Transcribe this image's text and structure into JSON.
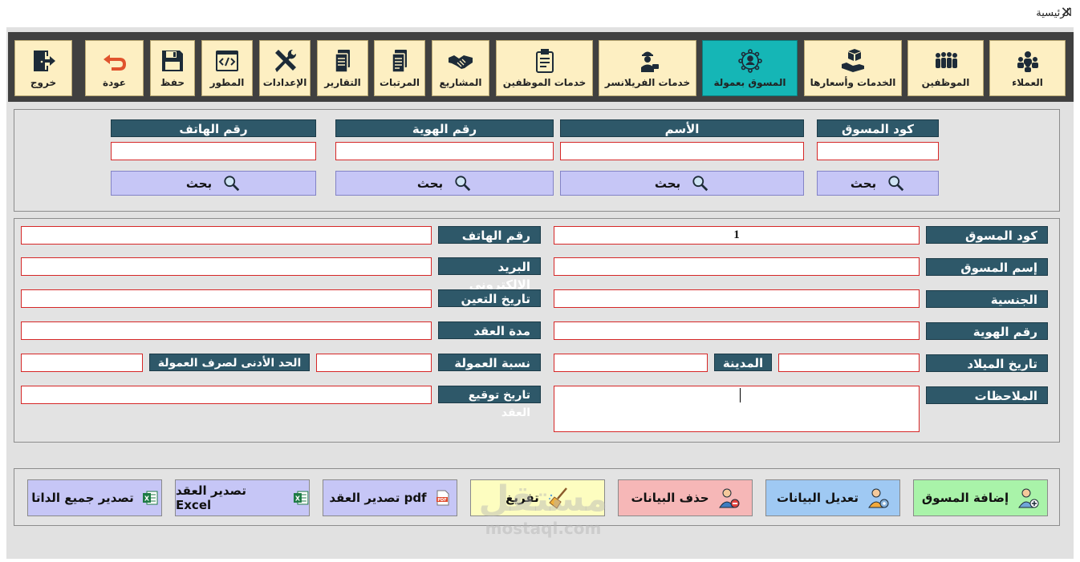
{
  "window": {
    "title": "الرئيسية",
    "close": "✕"
  },
  "toolbar": {
    "items": [
      {
        "id": "clients",
        "label": "العملاء",
        "icon": "group-icon"
      },
      {
        "id": "employees",
        "label": "الموظفين",
        "icon": "crowd-icon"
      },
      {
        "id": "services",
        "label": "الخدمات وأسعارها",
        "icon": "service-box-icon"
      },
      {
        "id": "commission-marketer",
        "label": "المسوق بعمولة",
        "icon": "network-person-icon",
        "active": true
      },
      {
        "id": "freelancer",
        "label": "خدمات الفريلانسر",
        "icon": "worker-icon"
      },
      {
        "id": "employee-services",
        "label": "خدمات الموظفين",
        "icon": "clipboard-icon"
      },
      {
        "id": "projects",
        "label": "المشاريع",
        "icon": "handshake-icon"
      },
      {
        "id": "salaries",
        "label": "المرتبات",
        "icon": "documents-icon"
      },
      {
        "id": "reports",
        "label": "التقارير",
        "icon": "report-icon"
      },
      {
        "id": "settings",
        "label": "الإعدادات",
        "icon": "tools-icon"
      },
      {
        "id": "developer",
        "label": "المطور",
        "icon": "code-icon"
      },
      {
        "id": "save",
        "label": "حفظ",
        "icon": "floppy-icon"
      },
      {
        "id": "back",
        "label": "عودة",
        "icon": "undo-arrow-icon"
      },
      {
        "id": "exit",
        "label": "خروج",
        "icon": "exit-door-icon"
      }
    ]
  },
  "search": {
    "columns": [
      {
        "id": "code",
        "header": "كود المسوق",
        "value": "",
        "button": "بحث"
      },
      {
        "id": "name",
        "header": "الأسم",
        "value": "",
        "button": "بحث"
      },
      {
        "id": "id-number",
        "header": "رقم الهوية",
        "value": "",
        "button": "بحث"
      },
      {
        "id": "phone",
        "header": "رقم الهاتف",
        "value": "",
        "button": "بحث"
      }
    ]
  },
  "details": {
    "right": {
      "code": {
        "label": "كود المسوق",
        "value": "1"
      },
      "name": {
        "label": "إسم المسوق",
        "value": ""
      },
      "nationality": {
        "label": "الجنسية",
        "value": ""
      },
      "id_number": {
        "label": "رقم الهوية",
        "value": ""
      },
      "birth_date": {
        "label": "تاريخ الميلاد",
        "value": ""
      },
      "city": {
        "label": "المدينة",
        "value": ""
      },
      "notes": {
        "label": "الملاحظات",
        "value": ""
      }
    },
    "left": {
      "phone": {
        "label": "رقم الهاتف",
        "value": ""
      },
      "email": {
        "label": "البريد الإلكتروني",
        "value": ""
      },
      "hire_date": {
        "label": "تاريخ التعين",
        "value": ""
      },
      "contract_duration": {
        "label": "مدة العقد",
        "value": ""
      },
      "commission_rate": {
        "label": "نسبة العمولة",
        "value": ""
      },
      "min_commission": {
        "label": "الحد الأدنى لصرف العمولة",
        "value": ""
      },
      "contract_sign_date": {
        "label": "تاريخ توقيع العقد",
        "value": ""
      }
    }
  },
  "actions": {
    "add": {
      "label": "إضافة المسوق",
      "color": "#a9f3a9",
      "icon": "add-user-icon"
    },
    "edit": {
      "label": "تعديل البيانات",
      "color": "#9fc9f3",
      "icon": "user-settings-icon"
    },
    "delete": {
      "label": "حذف البيانات",
      "color": "#f6b7b7",
      "icon": "remove-user-icon"
    },
    "clear": {
      "label": "تفريغ",
      "color": "#fdfdc0",
      "icon": "broom-icon"
    },
    "export_pdf": {
      "label": "تصدير العقد pdf",
      "color": "#c6c6f6",
      "icon": "pdf-file-icon"
    },
    "export_excel": {
      "label": "تصدير العقد Excel",
      "color": "#c6c6f6",
      "icon": "excel-file-icon"
    },
    "export_all": {
      "label": "تصدير جميع الداتا",
      "color": "#c6c6f6",
      "icon": "excel-file-icon"
    }
  },
  "watermark": {
    "arabic": "مستقل",
    "latin": "mostaql.com"
  }
}
